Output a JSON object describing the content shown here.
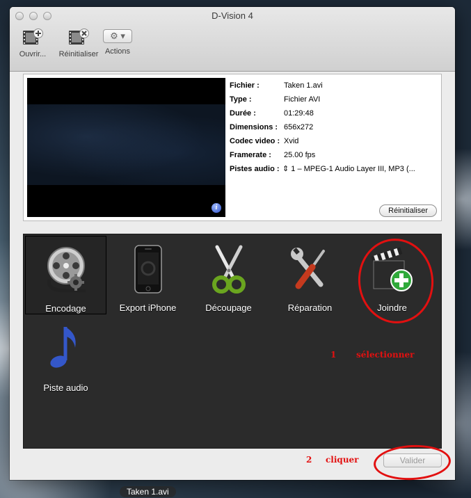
{
  "window": {
    "title": "D-Vision 4"
  },
  "toolbar": {
    "open_label": "Ouvrir...",
    "reset_label": "Réinitialiser",
    "actions_label": "Actions"
  },
  "info": {
    "rows": [
      {
        "key": "Fichier :",
        "value": "Taken 1.avi"
      },
      {
        "key": "Type :",
        "value": "Fichier AVI"
      },
      {
        "key": "Durée :",
        "value": "01:29:48"
      },
      {
        "key": "Dimensions :",
        "value": "656x272"
      },
      {
        "key": "Codec video :",
        "value": "Xvid"
      },
      {
        "key": "Framerate :",
        "value": "25.00 fps"
      }
    ],
    "audio_key": "Pistes audio :",
    "audio_value": "1 – MPEG-1 Audio Layer III, MP3 (...",
    "reset_button": "Réinitialiser"
  },
  "tools": [
    {
      "label": "Encodage",
      "icon": "film-reel-gear-icon",
      "selected": true
    },
    {
      "label": "Export iPhone",
      "icon": "iphone-icon",
      "selected": false
    },
    {
      "label": "Découpage",
      "icon": "scissors-icon",
      "selected": false
    },
    {
      "label": "Réparation",
      "icon": "wrench-screwdriver-icon",
      "selected": false
    },
    {
      "label": "Joindre",
      "icon": "clapperboard-plus-icon",
      "selected": false
    },
    {
      "label": "Piste audio",
      "icon": "music-note-icon",
      "selected": false
    }
  ],
  "annotations": {
    "step1_number": "1",
    "step1_text": "sélectionner",
    "step2_number": "2",
    "step2_text": "cliquer",
    "color": "#e21010"
  },
  "footer": {
    "validate_button": "Valider"
  },
  "dock": {
    "label": "Taken 1.avi"
  }
}
